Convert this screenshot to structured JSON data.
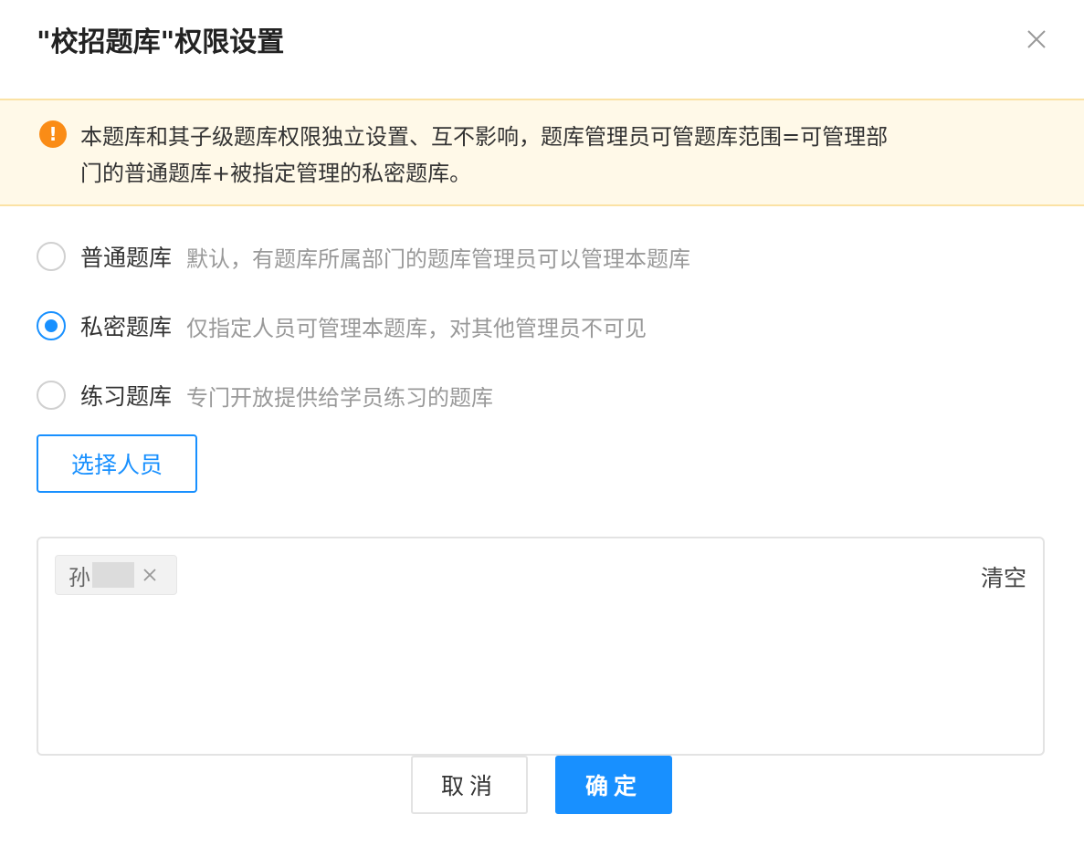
{
  "dialog": {
    "title": "\"校招题库\"权限设置",
    "close_icon": "close-icon"
  },
  "alert": {
    "icon": "exclamation-icon",
    "text": "本题库和其子级题库权限独立设置、互不影响，题库管理员可管题库范围=可管理部\n门的普通题库+被指定管理的私密题库。"
  },
  "options": [
    {
      "name": "普通题库",
      "desc": "默认，有题库所属部门的题库管理员可以管理本题库",
      "checked": false
    },
    {
      "name": "私密题库",
      "desc": "仅指定人员可管理本题库，对其他管理员不可见",
      "checked": true
    },
    {
      "name": "练习题库",
      "desc": "专门开放提供给学员练习的题库",
      "checked": false
    }
  ],
  "select_button": {
    "label": "选择人员"
  },
  "picker": {
    "tags": [
      {
        "name": "孙"
      }
    ],
    "clear_label": "清空"
  },
  "footer": {
    "cancel_label": "取消",
    "ok_label": "确定"
  },
  "colors": {
    "accent": "#1890ff",
    "warning": "#fa8c16",
    "alert_bg": "#fff9e8"
  }
}
